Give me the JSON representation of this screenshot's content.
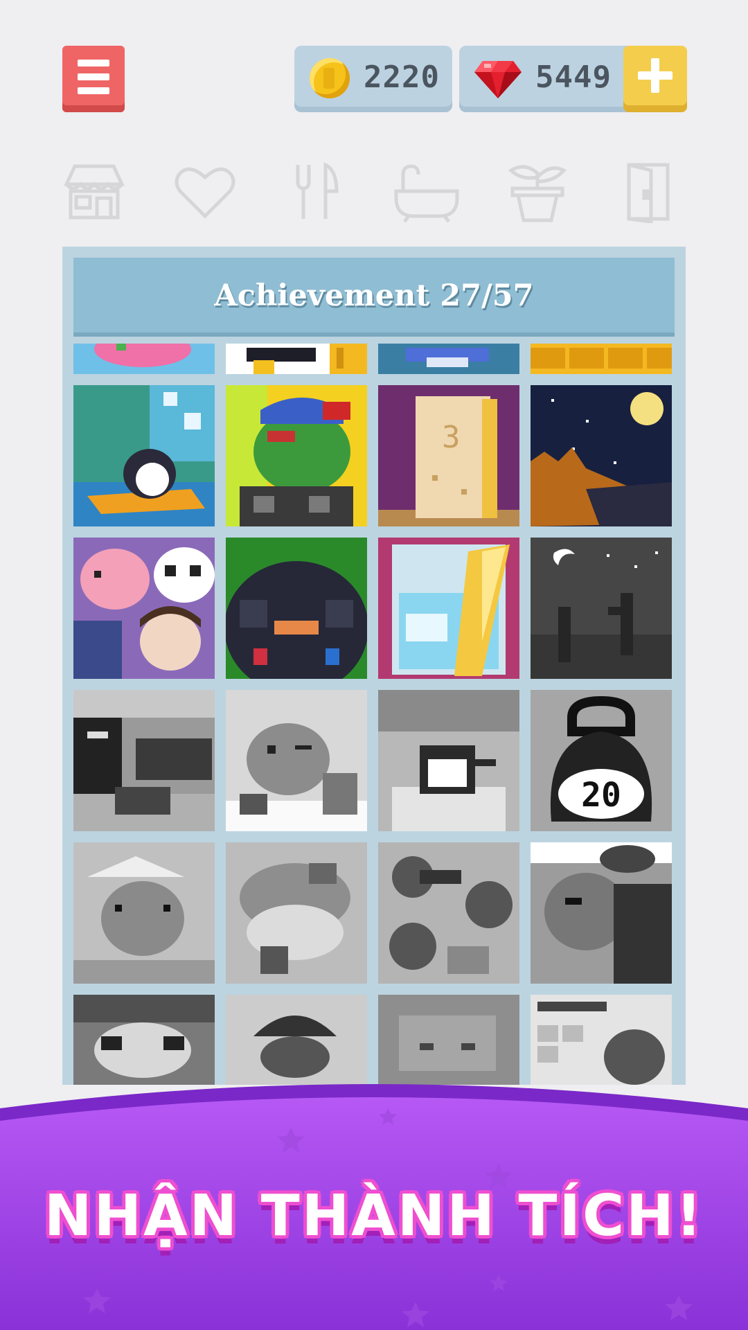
{
  "currency": {
    "coins": "2220",
    "gems": "5449"
  },
  "categories": [
    {
      "icon": "house-icon"
    },
    {
      "icon": "heart-icon"
    },
    {
      "icon": "utensils-icon"
    },
    {
      "icon": "bathtub-icon"
    },
    {
      "icon": "plant-pot-icon"
    },
    {
      "icon": "door-icon"
    }
  ],
  "achievements": {
    "title": "Achievement 27/57",
    "unlocked_rows": [
      [
        "penguin-surfing-art",
        "zombie-cap-art",
        "door-three-art",
        "cat-night-art"
      ],
      [
        "friends-group-art",
        "dark-blob-art",
        "water-jar-art",
        "night-cactus-art"
      ]
    ],
    "locked_tile_label": "20"
  },
  "banner": {
    "text": "NHẬN THÀNH TÍCH!"
  },
  "colors": {
    "background": "#efeef1",
    "menu_button": "#ef6565",
    "currency_bg": "#bcd2e1",
    "panel": "#bcd4e0",
    "panel_header": "#8fbdd3",
    "banner_purple": "#9b3fe0",
    "banner_text_outline": "#ee4fd0"
  }
}
